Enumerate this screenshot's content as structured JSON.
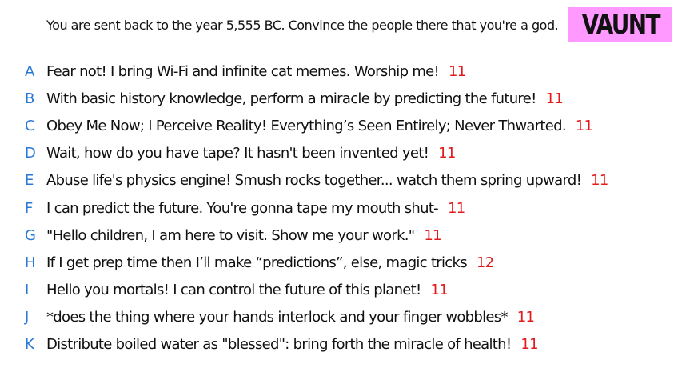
{
  "header": {
    "prompt": "You are sent back to the year 5,555 BC. Convince the people there that you're a god.",
    "brand": "VAUNT",
    "brand_color": "#ff99ff"
  },
  "colors": {
    "letter": "#2a78d6",
    "score": "#e11b1b",
    "text": "#111111"
  },
  "answers": [
    {
      "letter": "A",
      "text": "Fear not! I bring Wi-Fi and infinite cat memes. Worship me!",
      "score": "11"
    },
    {
      "letter": "B",
      "text": "With basic history knowledge, perform a miracle by predicting the future!",
      "score": "11"
    },
    {
      "letter": "C",
      "text": "Obey Me Now; I Perceive Reality! Everything’s Seen Entirely; Never Thwarted.",
      "score": "11"
    },
    {
      "letter": "D",
      "text": "Wait, how do you have tape? It hasn't been invented yet!",
      "score": "11"
    },
    {
      "letter": "E",
      "text": "Abuse life's physics engine! Smush rocks together... watch them spring upward!",
      "score": "11"
    },
    {
      "letter": "F",
      "text": "I can predict the future. You're gonna tape my mouth shut-",
      "score": "11"
    },
    {
      "letter": "G",
      "text": "\"Hello children, I am here to visit. Show me your work.\"",
      "score": "11"
    },
    {
      "letter": "H",
      "text": "If I get prep time then I’ll make “predictions”, else, magic tricks",
      "score": "12"
    },
    {
      "letter": "I",
      "text": "Hello you mortals! I can control the future of this planet!",
      "score": "11"
    },
    {
      "letter": "J",
      "text": "*does the thing where your hands interlock and your finger wobbles*",
      "score": "11"
    },
    {
      "letter": "K",
      "text": "Distribute boiled water as \"blessed\": bring forth the miracle of health!",
      "score": "11"
    }
  ]
}
